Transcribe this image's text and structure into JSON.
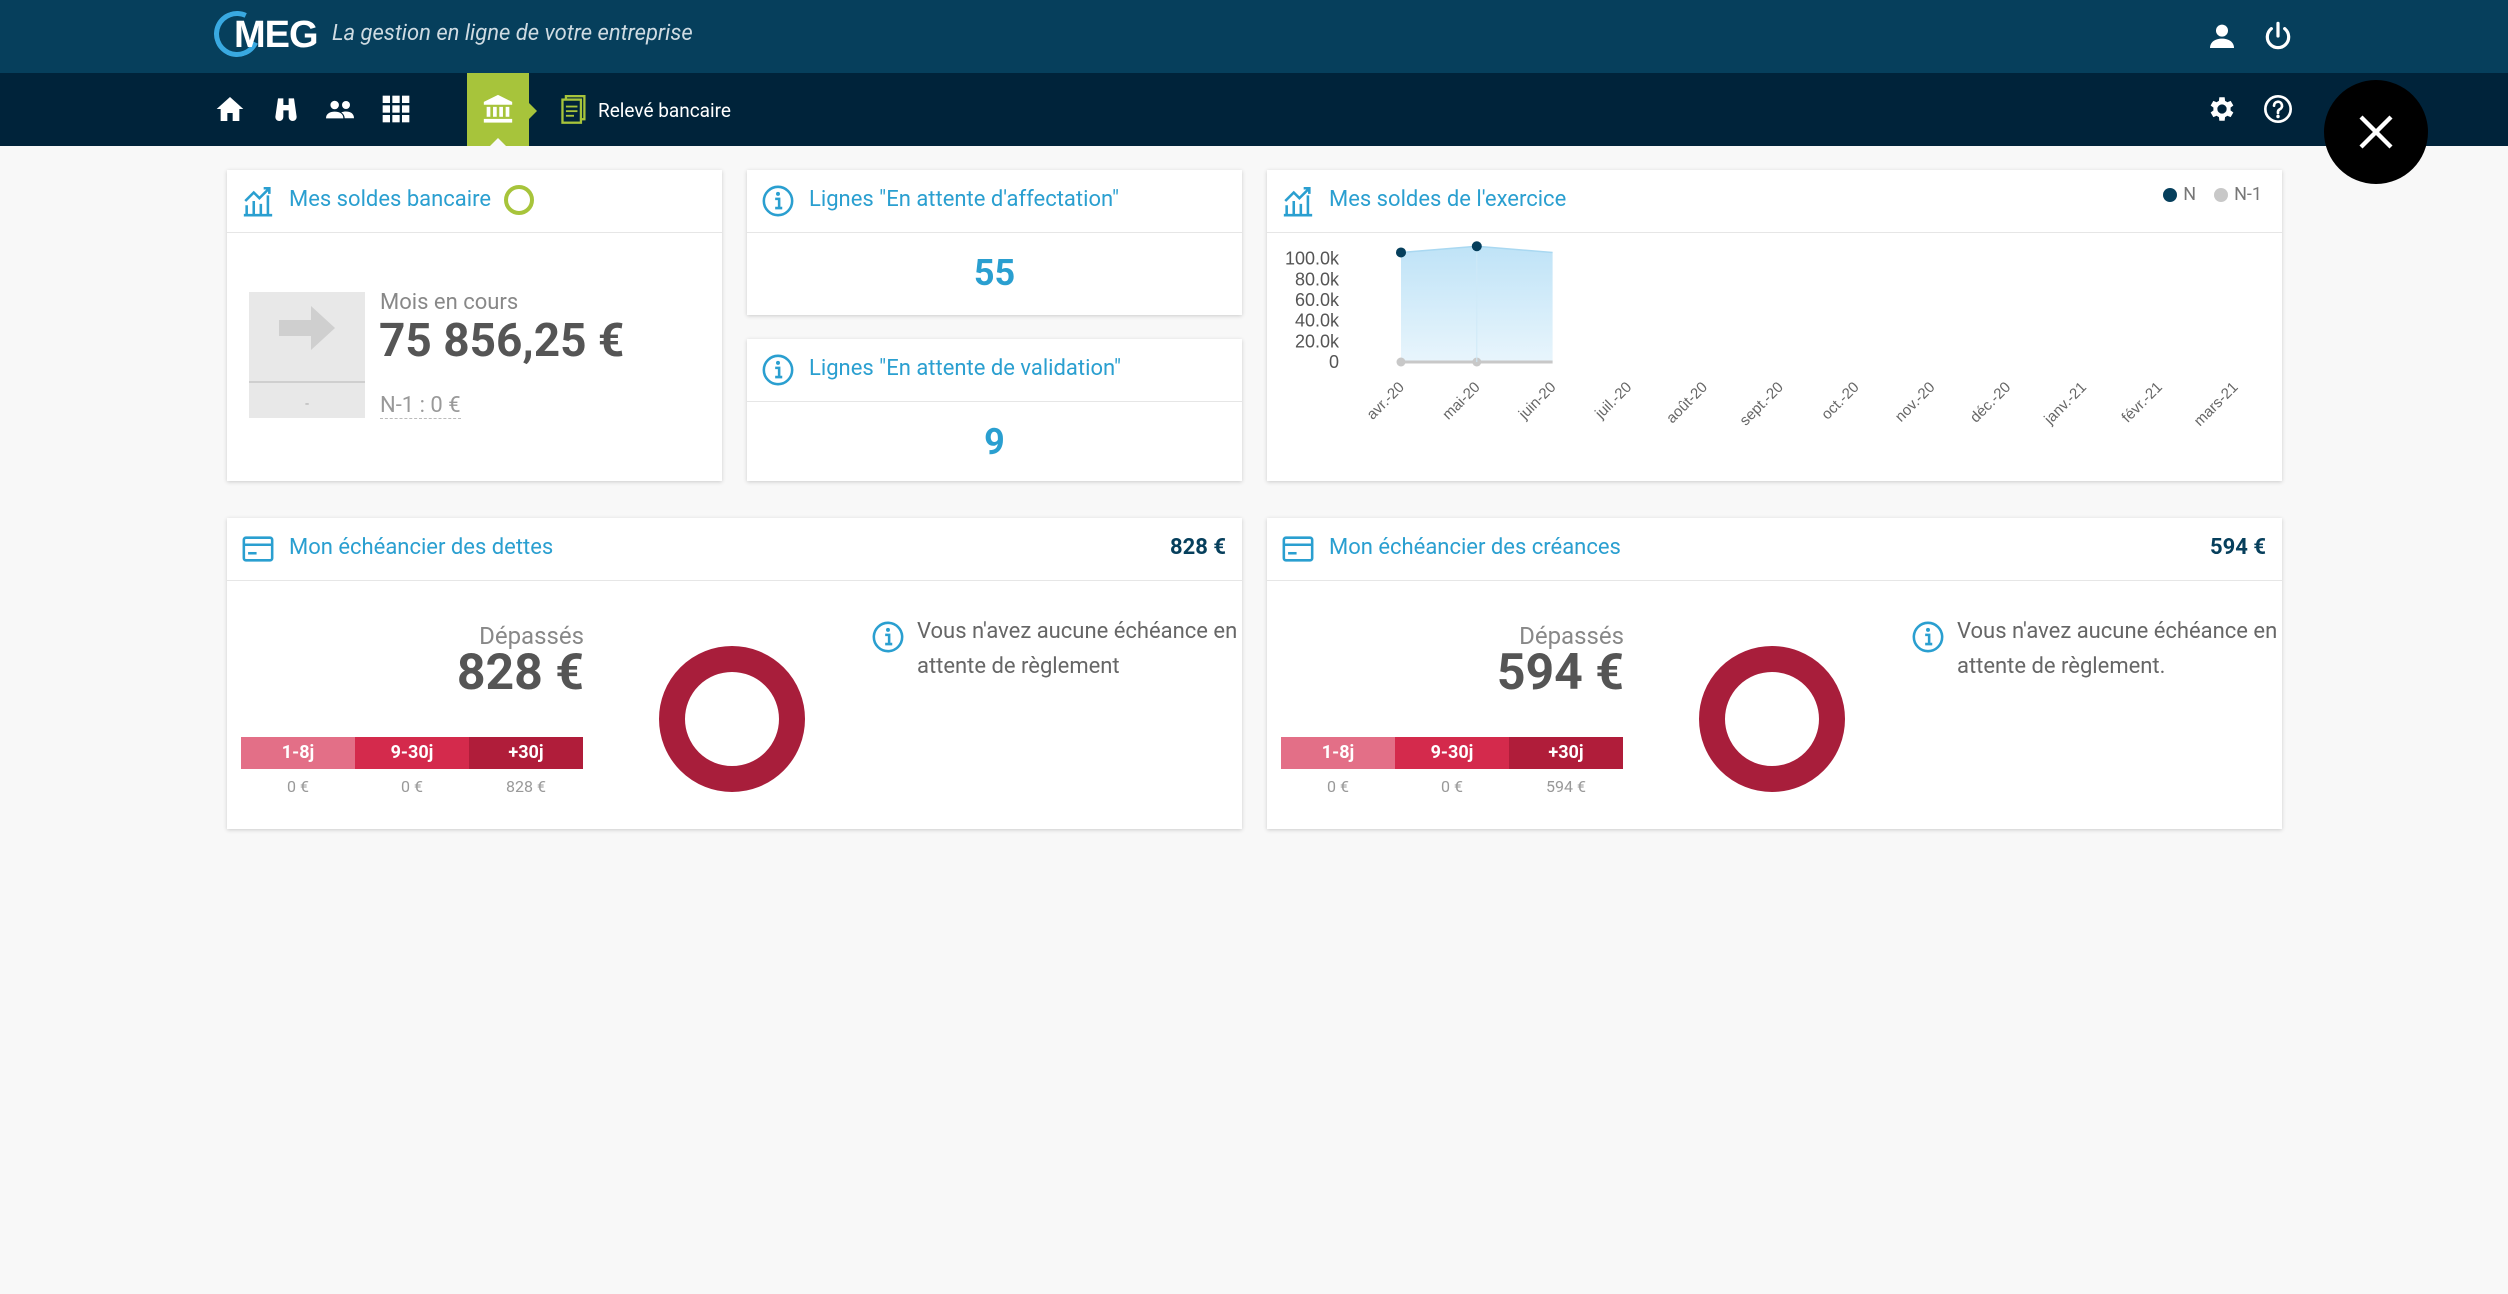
{
  "app": {
    "logo_text": "MEG",
    "tagline": "La gestion en ligne de votre entreprise"
  },
  "header_icons": [
    "user-icon",
    "power-icon"
  ],
  "nav": {
    "icons": [
      "home-icon",
      "binoculars-icon",
      "people-icon",
      "apps-grid-icon",
      "bank-icon"
    ],
    "breadcrumb_label": "Relevé bancaire",
    "right_icons": [
      "gear-icon",
      "help-icon"
    ]
  },
  "bank_balance": {
    "title": "Mes soldes bancaire",
    "month_label": "Mois en cours",
    "month_value": "75 856,25 €",
    "prev_year": "N-1 : 0 €",
    "placeholder_dash": "-"
  },
  "pending_assignment": {
    "title": "Lignes \"En attente d'affectation\"",
    "count": "55"
  },
  "pending_validation": {
    "title": "Lignes \"En attente de validation\"",
    "count": "9"
  },
  "fiscal_balance": {
    "title": "Mes soldes de l'exercice",
    "legend": {
      "current": "N",
      "previous": "N-1"
    }
  },
  "chart_data": {
    "type": "area",
    "title": "Mes soldes de l'exercice",
    "categories": [
      "avr.-20",
      "mai-20",
      "juin-20",
      "juil.-20",
      "août-20",
      "sept.-20",
      "oct.-20",
      "nov.-20",
      "déc.-20",
      "janv.-21",
      "févr.-21",
      "mars-21"
    ],
    "series": [
      {
        "name": "N",
        "values": [
          106000,
          112000,
          106000,
          null,
          null,
          null,
          null,
          null,
          null,
          null,
          null,
          null
        ],
        "color": "#063f5c"
      },
      {
        "name": "N-1",
        "values": [
          0,
          0,
          null,
          null,
          null,
          null,
          null,
          null,
          null,
          null,
          null,
          null
        ],
        "color": "#c8c8c8"
      }
    ],
    "y_ticks": [
      "0",
      "20.0k",
      "40.0k",
      "60.0k",
      "80.0k",
      "100.0k"
    ],
    "ylim": [
      0,
      120000
    ],
    "legend_position": "top-right",
    "grid": false
  },
  "debts": {
    "title": "Mon échéancier des dettes",
    "total": "828 €",
    "overdue_label": "Dépassés",
    "overdue_value": "828 €",
    "buckets": [
      {
        "label": "1-8j",
        "amount": "0 €",
        "color": "#e36f87"
      },
      {
        "label": "9-30j",
        "amount": "0 €",
        "color": "#d42a4c"
      },
      {
        "label": "+30j",
        "amount": "828 €",
        "color": "#b01d3a"
      }
    ],
    "info": "Vous n'avez aucune échéance en attente de règlement",
    "donut_color": "#a81e3b"
  },
  "receivables": {
    "title": "Mon échéancier des créances",
    "total": "594 €",
    "overdue_label": "Dépassés",
    "overdue_value": "594 €",
    "buckets": [
      {
        "label": "1-8j",
        "amount": "0 €",
        "color": "#e36f87"
      },
      {
        "label": "9-30j",
        "amount": "0 €",
        "color": "#d42a4c"
      },
      {
        "label": "+30j",
        "amount": "594 €",
        "color": "#b01d3a"
      }
    ],
    "info": "Vous n'avez aucune échéance en attente de règlement.",
    "donut_color": "#a81e3b"
  }
}
